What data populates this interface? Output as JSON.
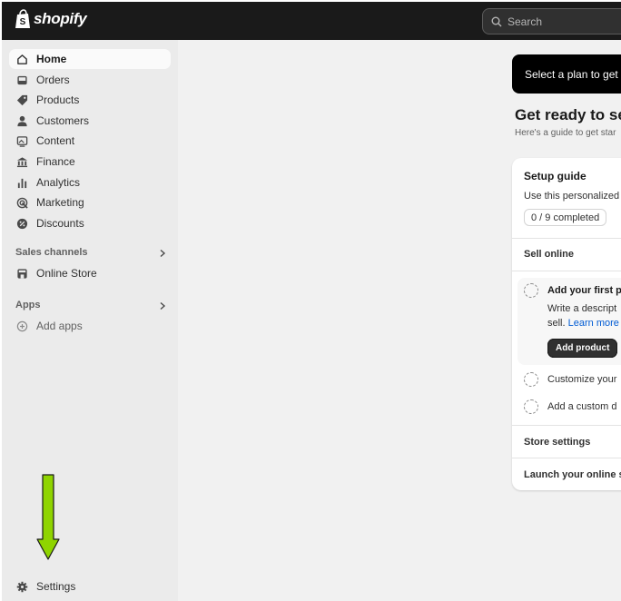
{
  "brand": {
    "name": "shopify"
  },
  "search": {
    "placeholder": "Search"
  },
  "sidebar": {
    "items": [
      {
        "label": "Home",
        "icon": "home-icon"
      },
      {
        "label": "Orders",
        "icon": "inbox-icon"
      },
      {
        "label": "Products",
        "icon": "tag-icon"
      },
      {
        "label": "Customers",
        "icon": "person-icon"
      },
      {
        "label": "Content",
        "icon": "image-icon"
      },
      {
        "label": "Finance",
        "icon": "bank-icon"
      },
      {
        "label": "Analytics",
        "icon": "bar-chart-icon"
      },
      {
        "label": "Marketing",
        "icon": "target-icon"
      },
      {
        "label": "Discounts",
        "icon": "discount-icon"
      }
    ],
    "sales_channels_title": "Sales channels",
    "online_store": "Online Store",
    "apps_title": "Apps",
    "add_apps": "Add apps",
    "settings": "Settings"
  },
  "main": {
    "banner": "Select a plan to get y",
    "title": "Get ready to se",
    "subtitle": "Here's a guide to get star",
    "setup": {
      "title": "Setup guide",
      "desc": "Use this personalized",
      "progress": "0 / 9 completed",
      "sell_online": "Sell online",
      "task1_title": "Add your first p",
      "task1_desc_line1": "Write a descript",
      "task1_desc_line2_prefix": "sell.",
      "task1_link": "Learn more",
      "add_product_button": "Add product",
      "task2": "Customize your",
      "task3": "Add a custom d",
      "store_settings": "Store settings",
      "launch": "Launch your online s"
    }
  },
  "colors": {
    "topbar": "#1a1a1a",
    "sidebar": "#ebebeb",
    "arrow": "#8fd400",
    "link": "#005bd3"
  }
}
